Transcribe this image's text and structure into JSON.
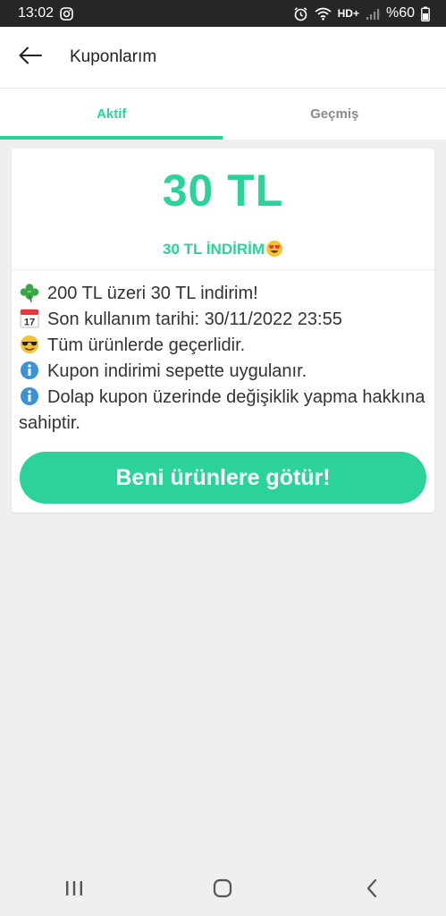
{
  "status_bar": {
    "time": "13:02",
    "network": "HD+",
    "battery_percent": "%60",
    "icons": [
      "instagram-icon",
      "alarm-icon",
      "wifi-icon",
      "signal-icon",
      "battery-icon"
    ]
  },
  "app_bar": {
    "title": "Kuponlarım",
    "back_icon": "back-arrow-icon"
  },
  "tabs": [
    {
      "label": "Aktif",
      "active": true
    },
    {
      "label": "Geçmiş",
      "active": false
    }
  ],
  "coupon": {
    "amount": "30 TL",
    "subtitle": "30 TL İNDİRİM",
    "subtitle_icon": "heart-eyes-emoji",
    "details": [
      {
        "icon": "clover-emoji",
        "text": "200 TL üzeri 30 TL indirim!"
      },
      {
        "icon": "calendar-emoji",
        "text": "Son kullanım tarihi: 30/11/2022 23:55"
      },
      {
        "icon": "sunglasses-emoji",
        "text": "Tüm ürünlerde geçerlidir."
      },
      {
        "icon": "info-emoji",
        "text": "Kupon indirimi sepette uygulanır."
      },
      {
        "icon": "info-emoji",
        "text": "Dolap kupon üzerinde değişiklik yapma hakkına sahiptir."
      }
    ],
    "cta_label": "Beni ürünlere götür!"
  },
  "colors": {
    "accent": "#2bd39a",
    "background": "#efefef",
    "status_bar": "#262626"
  },
  "nav_bar": [
    "recents-icon",
    "home-icon",
    "back-icon"
  ]
}
